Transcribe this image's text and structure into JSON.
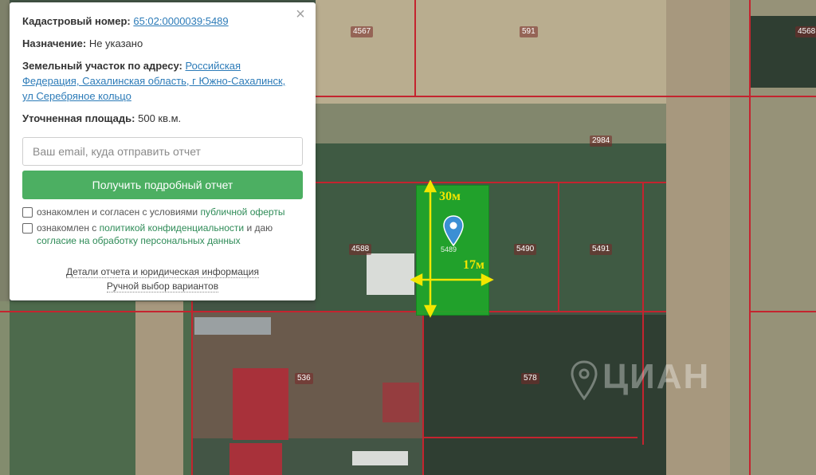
{
  "popup": {
    "cadastral_label": "Кадастровый номер:",
    "cadastral_number": "65:02:0000039:5489",
    "purpose_label": "Назначение:",
    "purpose_value": "Не указано",
    "address_label": "Земельный участок по адресу:",
    "address_line1": "Российская",
    "address_line2": "Федерация, Сахалинская область, г Южно-Сахалинск,",
    "address_line3": "ул Серебряное кольцо",
    "area_label": "Уточненная площадь:",
    "area_value": "500 кв.м.",
    "email_placeholder": "Ваш email, куда отправить отчет",
    "get_report_button": "Получить подробный отчет",
    "consent1_text": "ознакомлен и согласен с условиями",
    "consent1_link": "публичной оферты",
    "consent2_text_a": "ознакомлен с",
    "consent2_link_a": "политикой конфиденциальности",
    "consent2_text_b": "и даю",
    "consent2_link_b": "согласие на обработку персональных данных",
    "details_link": "Детали отчета и юридическая информация",
    "manual_link": "Ручной выбор вариантов",
    "close_icon": "×"
  },
  "map": {
    "parcel_labels": [
      "4567",
      "591",
      "4568",
      "2984",
      "4588",
      "5490",
      "5491",
      "536",
      "578"
    ],
    "selected_parcel_label": "5489",
    "dimension_height": "30м",
    "dimension_width": "17м",
    "watermark": "ЦИАН",
    "colors": {
      "selected_parcel": "#1fa82a",
      "cadastral_lines": "#c4242f",
      "dimension_text": "#f2e600"
    }
  }
}
